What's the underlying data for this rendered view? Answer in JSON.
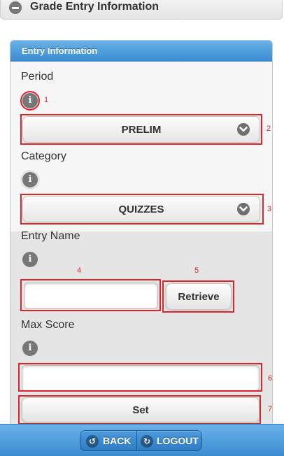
{
  "header": {
    "title": "Grade Entry Information"
  },
  "panel": {
    "title": "Entry Information",
    "period": {
      "label": "Period",
      "value": "PRELIM"
    },
    "category": {
      "label": "Category",
      "value": "QUIZZES"
    },
    "entry_name": {
      "label": "Entry Name",
      "value": "",
      "retrieve_label": "Retrieve"
    },
    "max_score": {
      "label": "Max Score",
      "value": "",
      "set_label": "Set"
    }
  },
  "info_icon_glyph": "i",
  "annotations": [
    "1",
    "2",
    "3",
    "4",
    "5",
    "6",
    "7"
  ],
  "footer": {
    "back_label": "BACK",
    "logout_label": "LOGOUT"
  },
  "colors": {
    "accent_blue": "#3a8dd3",
    "annotation_red": "#e0242b"
  },
  "icons": [
    "minus-icon",
    "info-icon",
    "chevron-down-icon",
    "back-icon",
    "logout-icon"
  ]
}
